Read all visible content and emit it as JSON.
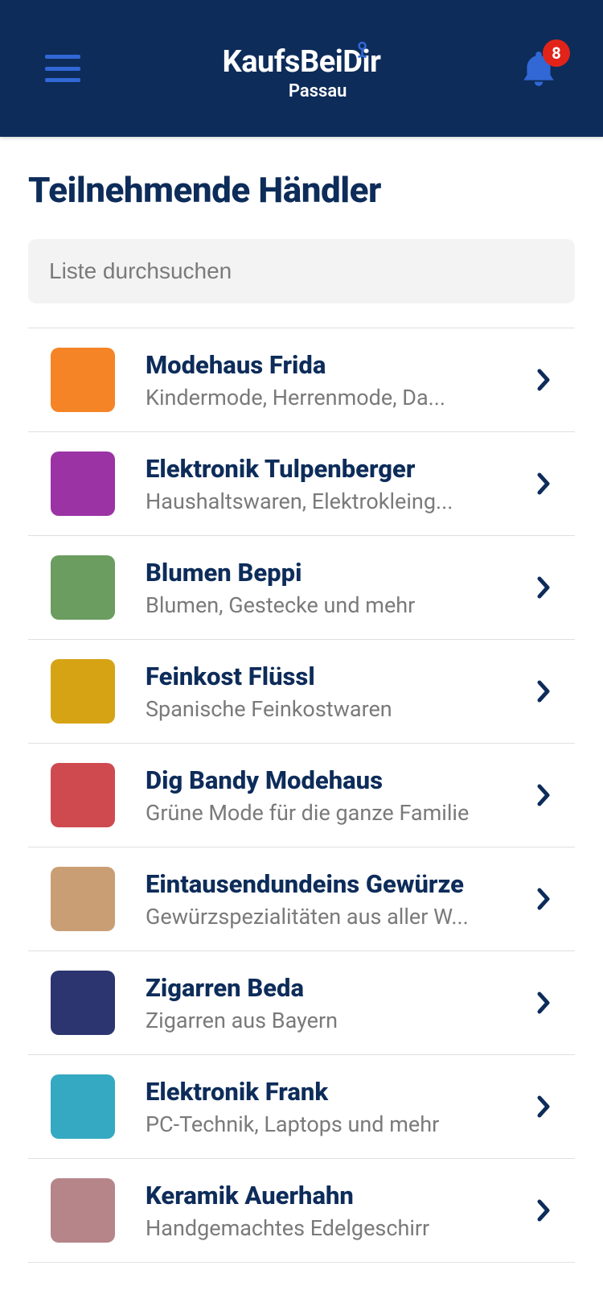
{
  "header": {
    "app_name": "KaufsBeiDir",
    "location": "Passau",
    "badge_count": "8"
  },
  "page": {
    "title": "Teilnehmende Händler",
    "search_placeholder": "Liste durchsuchen"
  },
  "merchants": [
    {
      "name": "Modehaus Frida",
      "subtitle": "Kindermode, Herrenmode, Da...",
      "color": "#f58426"
    },
    {
      "name": "Elektronik Tulpenberger",
      "subtitle": "Haushaltswaren, Elektrokleing...",
      "color": "#9b33a5"
    },
    {
      "name": "Blumen Beppi",
      "subtitle": "Blumen, Gestecke und mehr",
      "color": "#6a9d5f"
    },
    {
      "name": "Feinkost Flüssl",
      "subtitle": "Spanische Feinkostwaren",
      "color": "#d6a315"
    },
    {
      "name": "Dig Bandy Modehaus",
      "subtitle": "Grüne Mode für die ganze Familie",
      "color": "#cf4a4f"
    },
    {
      "name": "Eintausendundeins Gewürze",
      "subtitle": "Gewürzspezialitäten aus aller W...",
      "color": "#c99e75"
    },
    {
      "name": "Zigarren Beda",
      "subtitle": "Zigarren aus Bayern",
      "color": "#2c3570"
    },
    {
      "name": "Elektronik Frank",
      "subtitle": "PC-Technik, Laptops und mehr",
      "color": "#34a9c1"
    },
    {
      "name": "Keramik Auerhahn",
      "subtitle": "Handgemachtes Edelgeschirr",
      "color": "#b58589"
    }
  ]
}
